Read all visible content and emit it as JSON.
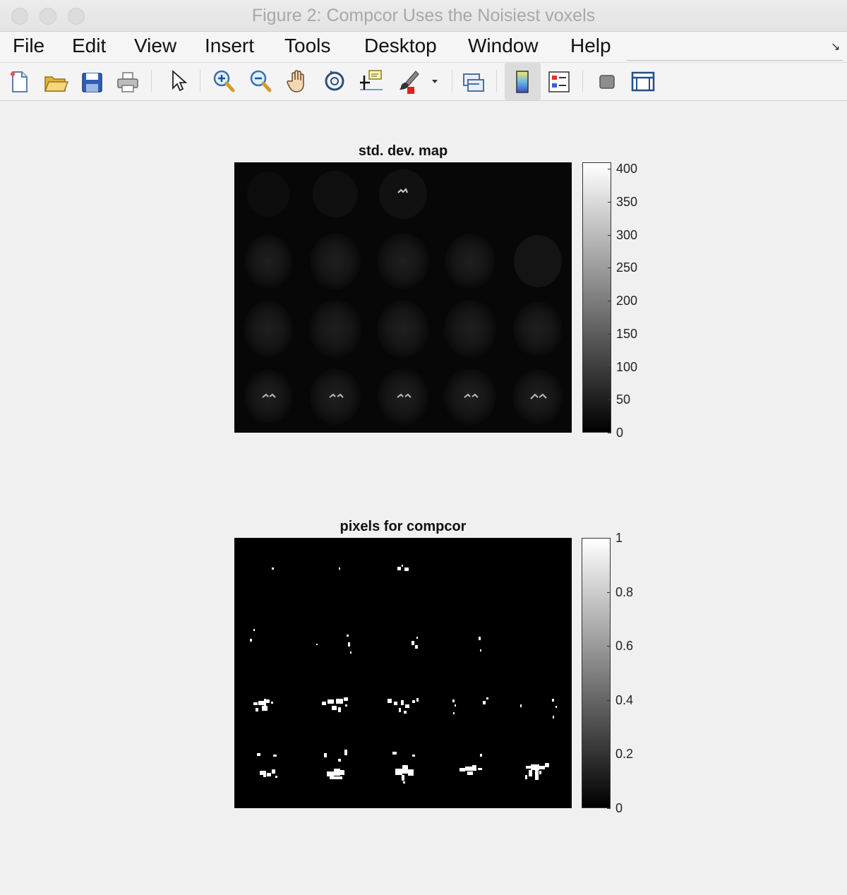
{
  "window": {
    "title": "Figure 2: Compcor Uses the Noisiest voxels"
  },
  "menu": [
    "File",
    "Edit",
    "View",
    "Insert",
    "Tools",
    "Desktop",
    "Window",
    "Help"
  ],
  "toolbar": [
    {
      "name": "new-figure-icon"
    },
    {
      "name": "open-file-icon"
    },
    {
      "name": "save-icon"
    },
    {
      "name": "print-icon"
    },
    {
      "name": "pointer-icon"
    },
    {
      "name": "zoom-in-icon"
    },
    {
      "name": "zoom-out-icon"
    },
    {
      "name": "pan-hand-icon"
    },
    {
      "name": "rotate-3d-icon"
    },
    {
      "name": "data-cursor-icon"
    },
    {
      "name": "brush-icon"
    },
    {
      "name": "link-plot-icon"
    },
    {
      "name": "colorbar-icon"
    },
    {
      "name": "legend-icon"
    },
    {
      "name": "hide-plot-tools-icon"
    },
    {
      "name": "show-plot-tools-icon"
    }
  ],
  "chart_data": [
    {
      "type": "heatmap",
      "title": "std. dev. map",
      "colormap": "gray",
      "clim": [
        0,
        410
      ],
      "colorbar_ticks": [
        "0",
        "50",
        "100",
        "150",
        "200",
        "250",
        "300",
        "350",
        "400"
      ],
      "grid_layout": "4 rows x 5 columns of brain slices"
    },
    {
      "type": "heatmap",
      "title": "pixels for compcor",
      "colormap": "gray",
      "clim": [
        0,
        1
      ],
      "colorbar_ticks": [
        "0",
        "0.2",
        "0.4",
        "0.6",
        "0.8",
        "1"
      ],
      "grid_layout": "4 rows x 5 columns of brain slices"
    }
  ]
}
